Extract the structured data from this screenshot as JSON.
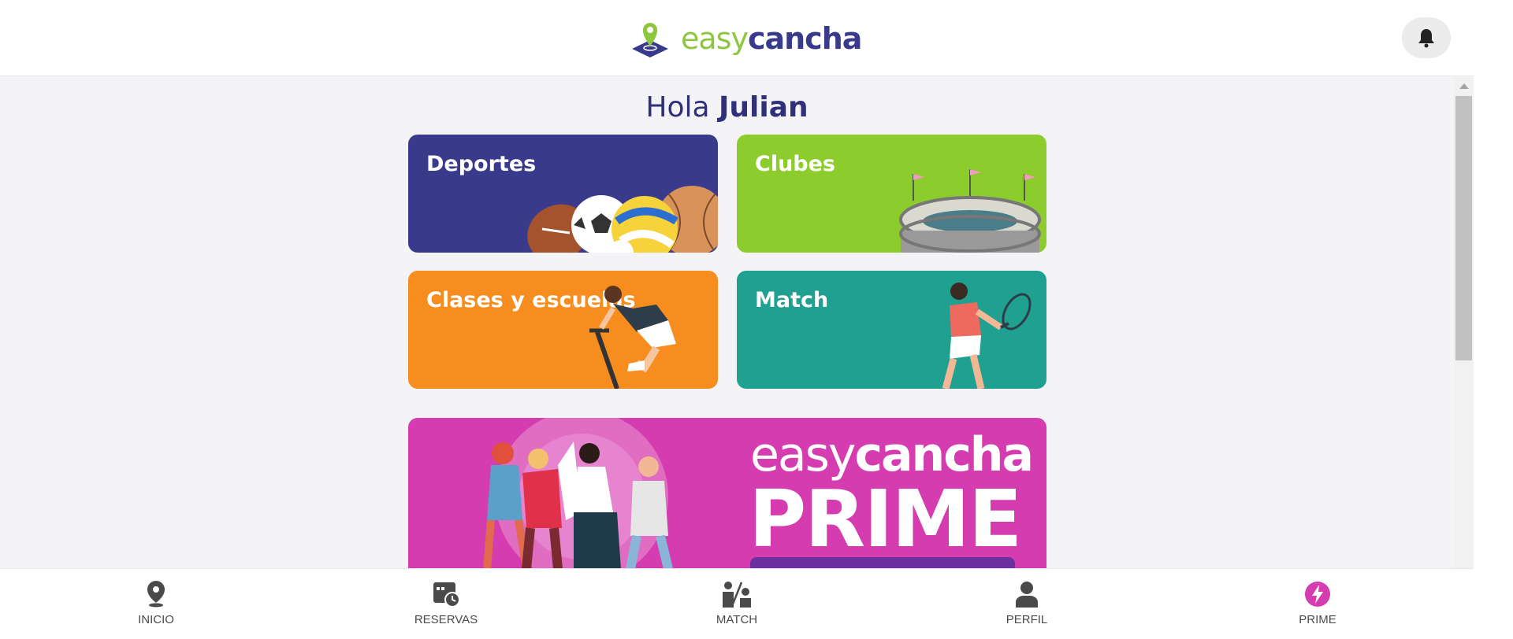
{
  "header": {
    "logo_easy": "easy",
    "logo_cancha": "cancha",
    "bell_icon": "bell-icon"
  },
  "greeting": {
    "hello": "Hola",
    "name": "Julian"
  },
  "cards": {
    "deportes": "Deportes",
    "clubes": "Clubes",
    "clases": "Clases y escuelas",
    "match": "Match"
  },
  "prime_banner": {
    "easy": "easy",
    "cancha": "cancha",
    "prime": "PRIME"
  },
  "nav": {
    "inicio": "INICIO",
    "reservas": "RESERVAS",
    "match": "MATCH",
    "perfil": "PERFIL",
    "prime": "PRIME"
  },
  "colors": {
    "brand_purple": "#3a3a8c",
    "brand_green": "#8dc63f",
    "orange": "#f78d1e",
    "teal": "#1fa091",
    "prime_pink": "#d43caf"
  }
}
